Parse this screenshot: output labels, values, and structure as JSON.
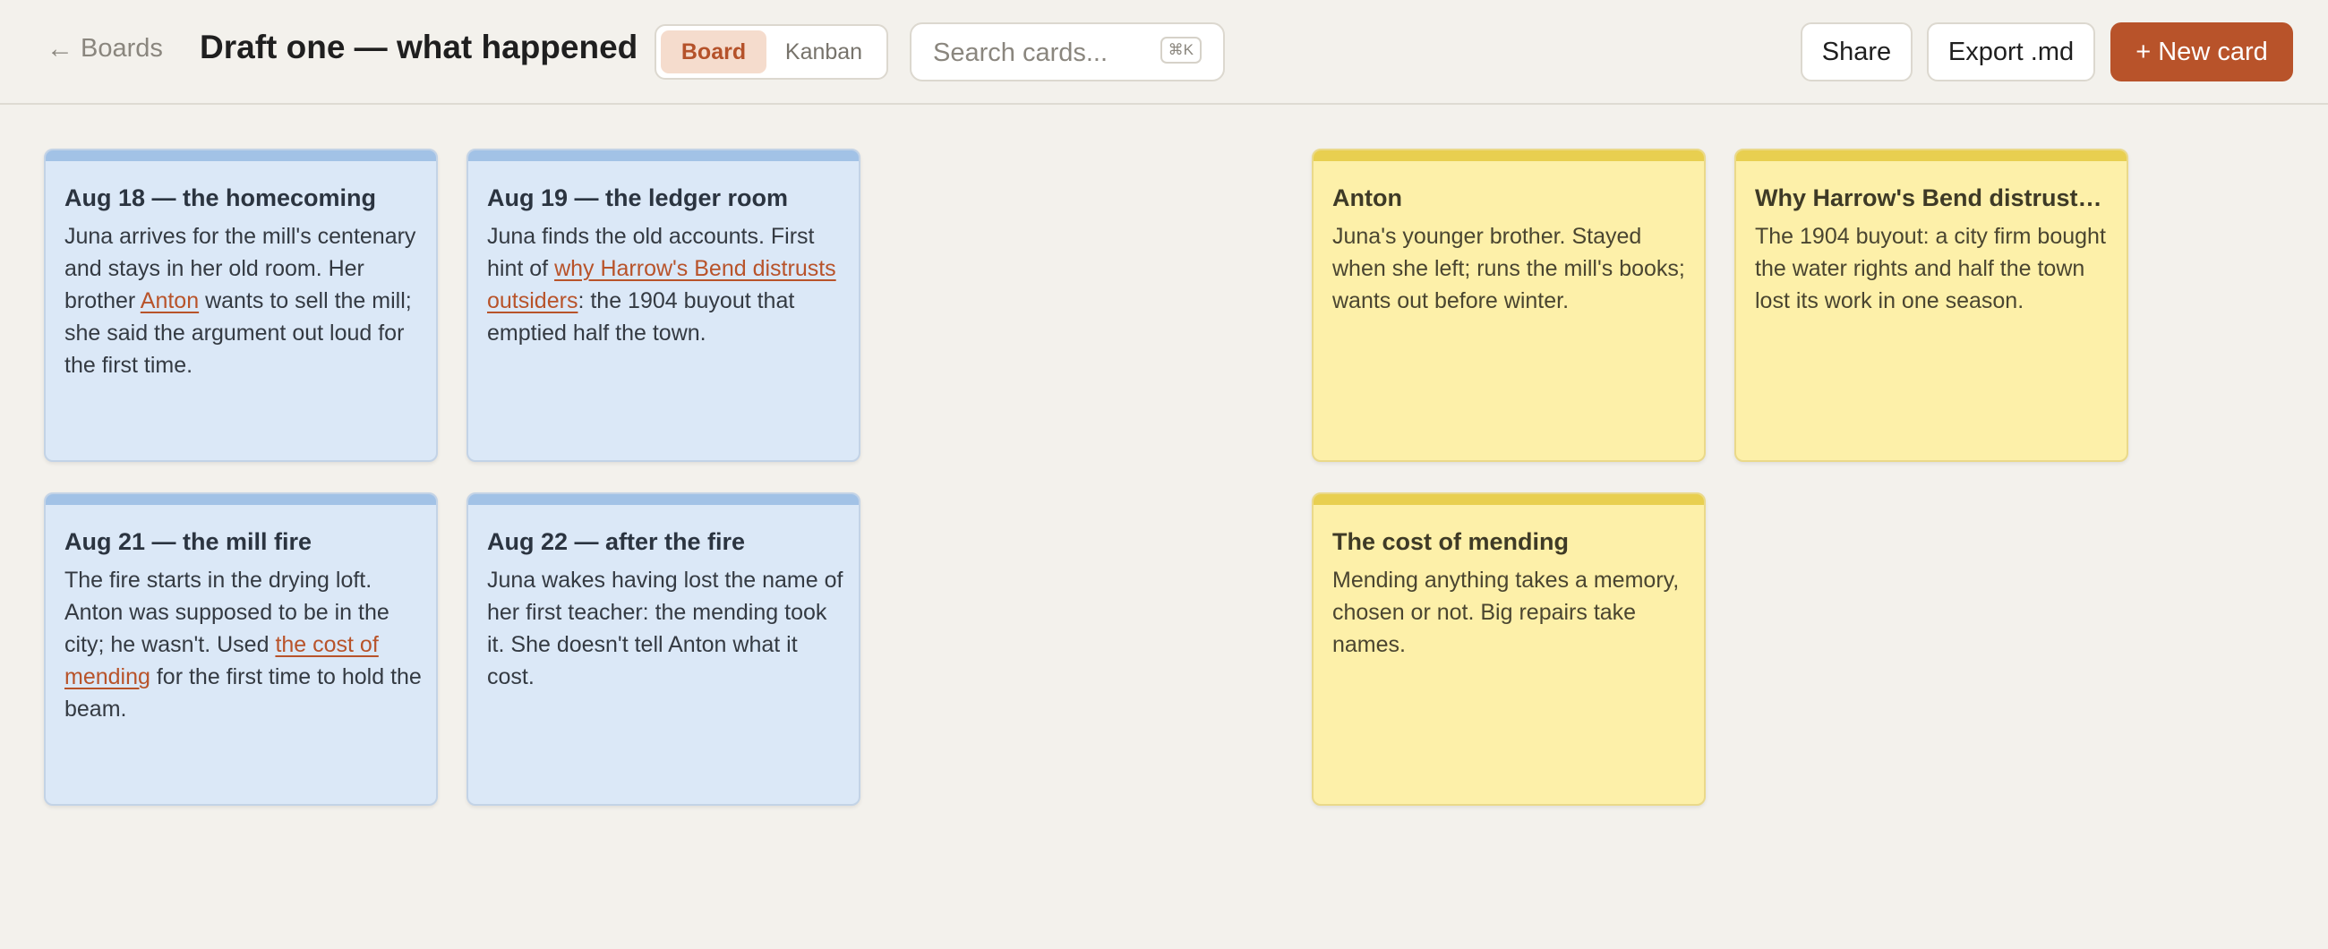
{
  "header": {
    "back_arrow": "←",
    "back_label": "Boards",
    "title": "Draft one — what happened",
    "view_tabs": [
      {
        "label": "Board",
        "active": true
      },
      {
        "label": "Kanban",
        "active": false
      }
    ],
    "search": {
      "placeholder": "Search cards...",
      "shortcut": "⌘K"
    },
    "actions": {
      "share": "Share",
      "export": "Export .md",
      "new_card": "+ New card"
    }
  },
  "colors": {
    "accent": "#b8532a",
    "scene_card": "#dbe8f7",
    "scene_stripe": "#a2c2e6",
    "note_card": "#fdf0a9",
    "note_stripe": "#e8cf50",
    "background": "#f3f1ec"
  },
  "cards": [
    {
      "kind": "scene",
      "title": "Aug 18 — the homecoming",
      "body": [
        {
          "text": "Juna arrives for the mill's centenary and stays in her old room. Her brother "
        },
        {
          "text": "Anton",
          "link": true
        },
        {
          "text": " wants to sell the mill; she said the argument out loud for the first time."
        }
      ]
    },
    {
      "kind": "scene",
      "title": "Aug 19 — the ledger room",
      "body": [
        {
          "text": "Juna finds the old accounts. First hint of "
        },
        {
          "text": "why Harrow's Bend distrusts outsiders",
          "link": true
        },
        {
          "text": ": the 1904 buyout that emptied half the town."
        }
      ]
    },
    {
      "kind": "note",
      "title": "Anton",
      "body": [
        {
          "text": "Juna's younger brother. Stayed when she left; runs the mill's books; wants out before winter."
        }
      ]
    },
    {
      "kind": "note",
      "title": "Why Harrow's Bend distrusts ...",
      "body": [
        {
          "text": "The 1904 buyout: a city firm bought the water rights and half the town lost its work in one season."
        }
      ]
    },
    {
      "kind": "scene",
      "title": "Aug 21 — the mill fire",
      "body": [
        {
          "text": "The fire starts in the drying loft. Anton was supposed to be in the city; he wasn't. Used "
        },
        {
          "text": "the cost of mending",
          "link": true
        },
        {
          "text": " for the first time to hold the beam."
        }
      ]
    },
    {
      "kind": "scene",
      "title": "Aug 22 — after the fire",
      "body": [
        {
          "text": "Juna wakes having lost the name of her first teacher: the mending took it. She doesn't tell Anton what it cost."
        }
      ]
    },
    {
      "kind": "note",
      "title": "The cost of mending",
      "body": [
        {
          "text": "Mending anything takes a memory, chosen or not. Big repairs take names."
        }
      ]
    }
  ]
}
